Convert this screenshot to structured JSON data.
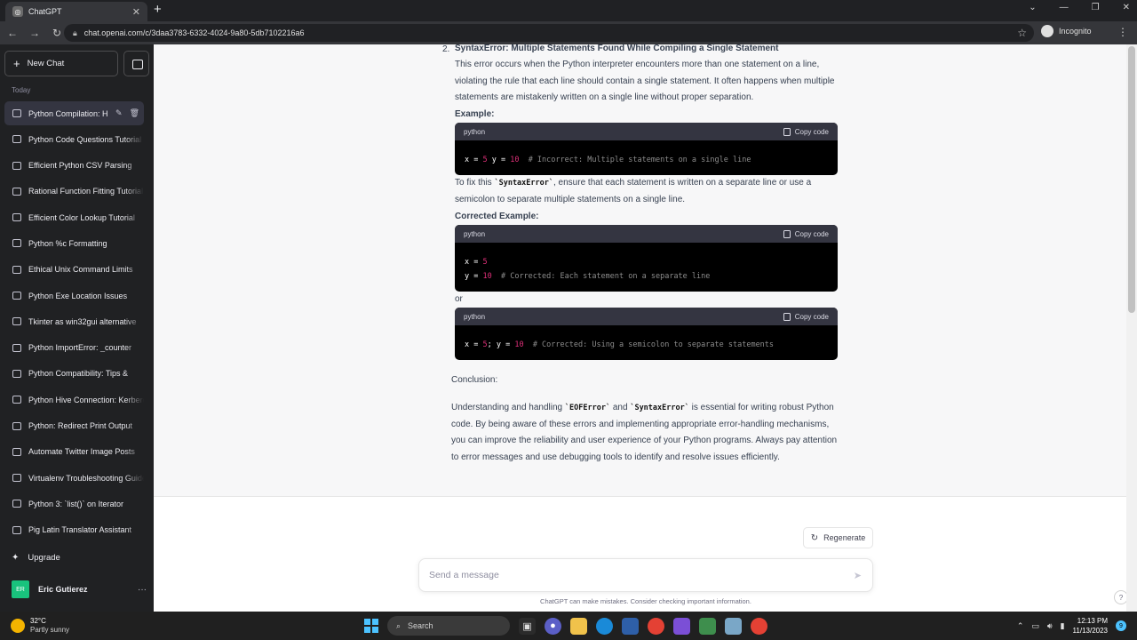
{
  "browser": {
    "tab_title": "ChatGPT",
    "url": "chat.openai.com/c/3daa3783-6332-4024-9a80-5db7102216a6",
    "incognito_label": "Incognito"
  },
  "sidebar": {
    "new_chat": "New Chat",
    "section": "Today",
    "items": [
      {
        "label": "Python Compilation: H"
      },
      {
        "label": "Python Code Questions Tutorial"
      },
      {
        "label": "Efficient Python CSV Parsing"
      },
      {
        "label": "Rational Function Fitting Tutorial"
      },
      {
        "label": "Efficient Color Lookup Tutorial"
      },
      {
        "label": "Python %c Formatting"
      },
      {
        "label": "Ethical Unix Command Limits"
      },
      {
        "label": "Python Exe Location Issues"
      },
      {
        "label": "Tkinter as win32gui alternative"
      },
      {
        "label": "Python ImportError: _counter"
      },
      {
        "label": "Python Compatibility: Tips &"
      },
      {
        "label": "Python Hive Connection: Kerberos"
      },
      {
        "label": "Python: Redirect Print Output"
      },
      {
        "label": "Automate Twitter Image Posts"
      },
      {
        "label": "Virtualenv Troubleshooting Guide"
      },
      {
        "label": "Python 3: `list()` on Iterator"
      },
      {
        "label": "Pig Latin Translator Assistant"
      }
    ],
    "upgrade": "Upgrade",
    "user_initials": "ER",
    "user_name": "Eric Gutierez"
  },
  "content": {
    "item_number": "2.",
    "heading": "SyntaxError: Multiple Statements Found While Compiling a Single Statement",
    "para1": "This error occurs when the Python interpreter encounters more than one statement on a line, violating the rule that each line should contain a single statement. It often happens when multiple statements are mistakenly written on a single line without proper separation.",
    "example_label": "Example:",
    "fix_pre": "To fix this ",
    "fix_code": "`SyntaxError`",
    "fix_post": ", ensure that each statement is written on a separate line or use a semicolon to separate multiple statements on a single line.",
    "corrected_label": "Corrected Example:",
    "or_text": "or",
    "conclusion_label": "Conclusion:",
    "concl_pre": "Understanding and handling ",
    "concl_code1": "`EOFError`",
    "concl_and": " and ",
    "concl_code2": "`SyntaxError`",
    "concl_post": " is essential for writing robust Python code. By being aware of these errors and implementing appropriate error-handling mechanisms, you can improve the reliability and user experience of your Python programs. Always pay attention to error messages and use debugging tools to identify and resolve issues efficiently."
  },
  "code_blocks": {
    "lang": "python",
    "copy_label": "Copy code",
    "b1": {
      "c1": "x = ",
      "n1": "5",
      "c2": " y = ",
      "n2": "10",
      "cmt": "  # Incorrect: Multiple statements on a single line"
    },
    "b2": {
      "l1a": "x = ",
      "l1n": "5",
      "l2a": "y = ",
      "l2n": "10",
      "cmt": "  # Corrected: Each statement on a separate line"
    },
    "b3": {
      "c1": "x = ",
      "n1": "5",
      "c2": "; y = ",
      "n2": "10",
      "cmt": "  # Corrected: Using a semicolon to separate statements"
    }
  },
  "composer": {
    "regenerate": "Regenerate",
    "placeholder": "Send a message",
    "disclaimer": "ChatGPT can make mistakes. Consider checking important information."
  },
  "taskbar": {
    "temp": "32°C",
    "weather": "Partly sunny",
    "search": "Search",
    "time": "12:13 PM",
    "date": "11/13/2023",
    "notif_count": "9"
  }
}
